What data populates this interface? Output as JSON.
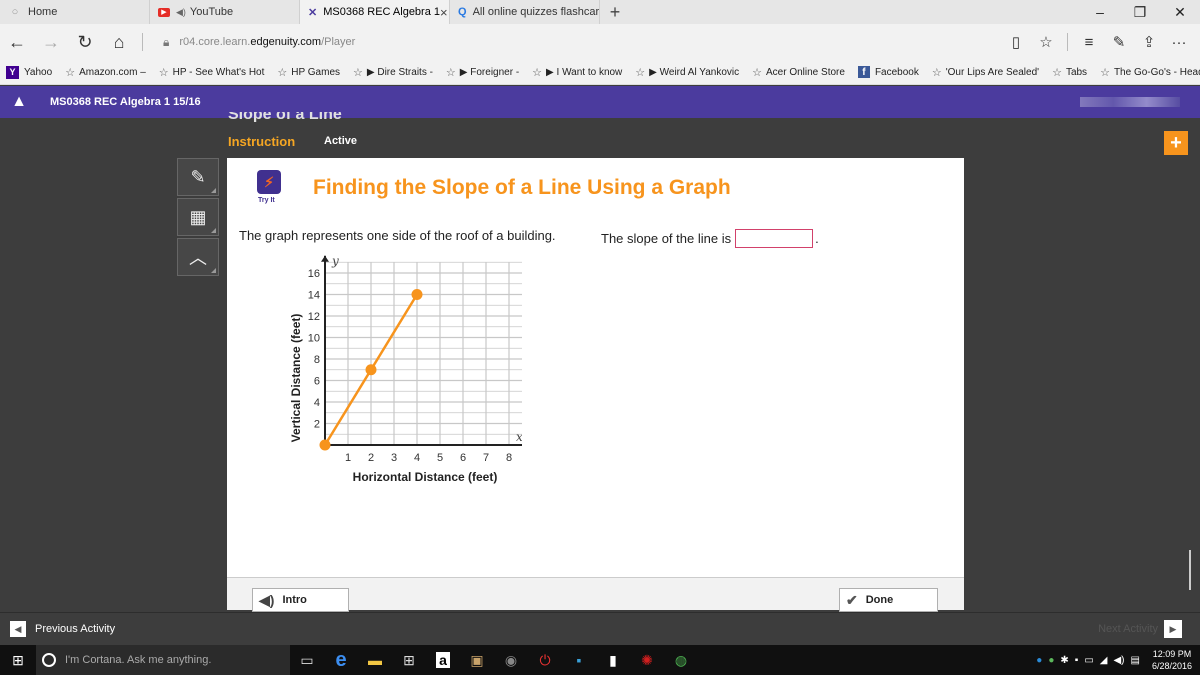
{
  "browser": {
    "tabs": [
      {
        "label": "Home",
        "icon": "home-circle-icon",
        "active": false
      },
      {
        "label": "YouTube",
        "icon": "youtube-icon",
        "active": false
      },
      {
        "label": "MS0368 REC Algebra 1",
        "icon": "edgenuity-x-icon",
        "active": true
      },
      {
        "label": "All online quizzes flashcards",
        "icon": "quizlet-icon",
        "active": false
      }
    ],
    "url_prefix": "r04.core.learn.",
    "url_domain": "edgenuity.com",
    "url_path": "/Player"
  },
  "favorites": [
    {
      "label": "Yahoo",
      "icon": "yahoo-icon"
    },
    {
      "label": "Amazon.com –",
      "icon": "star-icon"
    },
    {
      "label": "HP - See What's Hot",
      "icon": "star-icon"
    },
    {
      "label": "HP Games",
      "icon": "star-icon"
    },
    {
      "label": "▶ Dire Straits -",
      "icon": "star-icon"
    },
    {
      "label": "▶ Foreigner -",
      "icon": "star-icon"
    },
    {
      "label": "▶ I Want to know",
      "icon": "star-icon"
    },
    {
      "label": "▶ Weird Al Yankovic",
      "icon": "star-icon"
    },
    {
      "label": "Acer Online Store",
      "icon": "star-icon"
    },
    {
      "label": "Facebook",
      "icon": "facebook-icon"
    },
    {
      "label": "'Our Lips Are Sealed'",
      "icon": "star-icon"
    },
    {
      "label": "Tabs",
      "icon": "star-icon"
    },
    {
      "label": "The Go-Go's - Head",
      "icon": "star-icon"
    }
  ],
  "course": {
    "title": "MS0368 REC Algebra 1 15/16"
  },
  "activity": {
    "partial_title": "Slope of a Line",
    "section": "Instruction",
    "status": "Active"
  },
  "content": {
    "tryit_label": "Try It",
    "heading": "Finding the Slope of a Line Using a Graph",
    "prompt": "The graph represents one side of the roof of a building.",
    "slope_question": "The slope of the line is",
    "slope_value": "",
    "period": "."
  },
  "buttons": {
    "intro": "Intro",
    "done": "Done",
    "previous": "Previous Activity",
    "next": "Next Activity"
  },
  "taskbar": {
    "cortana_placeholder": "I'm Cortana. Ask me anything.",
    "time": "12:09 PM",
    "date": "6/28/2016"
  },
  "chart_data": {
    "type": "line",
    "xlabel": "Horizontal Distance (feet)",
    "ylabel": "Vertical Distance (feet)",
    "x_axis_var": "x",
    "y_axis_var": "y",
    "x_ticks": [
      1,
      2,
      3,
      4,
      5,
      6,
      7,
      8
    ],
    "y_ticks": [
      2,
      4,
      6,
      8,
      10,
      12,
      14,
      16
    ],
    "xlim": [
      0,
      9
    ],
    "ylim": [
      0,
      17
    ],
    "grid": true,
    "series": [
      {
        "x": [
          0,
          2,
          4
        ],
        "y": [
          0,
          7,
          14
        ]
      }
    ],
    "colors": {
      "line": "#f7941d",
      "grid": "#c8c8c8",
      "axis": "#222222"
    }
  }
}
